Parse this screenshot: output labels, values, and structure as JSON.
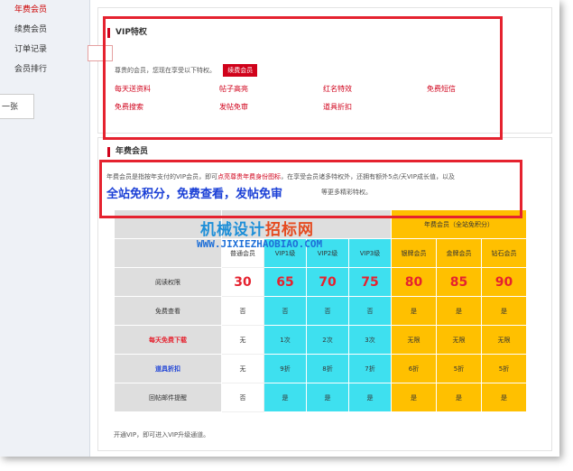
{
  "sidebar": {
    "items": [
      {
        "label": "年费会员"
      },
      {
        "label": "续费会员"
      },
      {
        "label": "订单记录"
      },
      {
        "label": "会员排行"
      }
    ],
    "stub_text": "一张"
  },
  "vip_section": {
    "title": "VIP特权",
    "intro": "尊贵的会员，您现在享受以下特权。",
    "renew_button": "续费会员",
    "privileges": [
      "每天送资料",
      "帖子高亮",
      "红名特效",
      "免费短信",
      "免费搜索",
      "发帖免审",
      "道具折扣"
    ]
  },
  "annual_section": {
    "title": "年费会员",
    "desc_prefix": "年费会员是指按年支付的VIP会员，即可",
    "desc_highlight": "点亮尊贵年费身份图标",
    "desc_suffix": "，在享受会员诸多特权外，还拥有额外5点/天VIP成长值，以及",
    "slogan": "全站免积分，免费查看，发帖免审",
    "slogan_tail": "等更多精彩特权。",
    "watermark_cn_a": "机械设计",
    "watermark_cn_b": "招标网",
    "watermark_url": "WWW.JIXIEZHAOBIAO.COM",
    "footer": "开通VIP，即可进入VIP升级通道。"
  },
  "table": {
    "group_header": "年费会员（全站免积分）",
    "columns": [
      "普通会员",
      "VIP1级",
      "VIP2级",
      "VIP3级",
      "银牌会员",
      "金牌会员",
      "钻石会员"
    ],
    "rows": [
      {
        "label": "阅读权限",
        "values": [
          "30",
          "65",
          "70",
          "75",
          "80",
          "85",
          "90"
        ]
      },
      {
        "label": "免费查看",
        "values": [
          "否",
          "否",
          "否",
          "否",
          "是",
          "是",
          "是"
        ]
      },
      {
        "label": "每天免费下载",
        "values": [
          "无",
          "1次",
          "2次",
          "3次",
          "无限",
          "无限",
          "无限"
        ]
      },
      {
        "label": "道具折扣",
        "values": [
          "无",
          "9折",
          "8折",
          "7折",
          "6折",
          "5折",
          "5折"
        ]
      },
      {
        "label": "回帖邮件提醒",
        "values": [
          "否",
          "是",
          "是",
          "是",
          "是",
          "是",
          "是"
        ]
      }
    ]
  },
  "colors": {
    "accent_red": "#e5222f",
    "vip_cyan": "#3ee0ef",
    "annual_gold": "#ffc000",
    "slogan_blue": "#1a3fd6"
  }
}
